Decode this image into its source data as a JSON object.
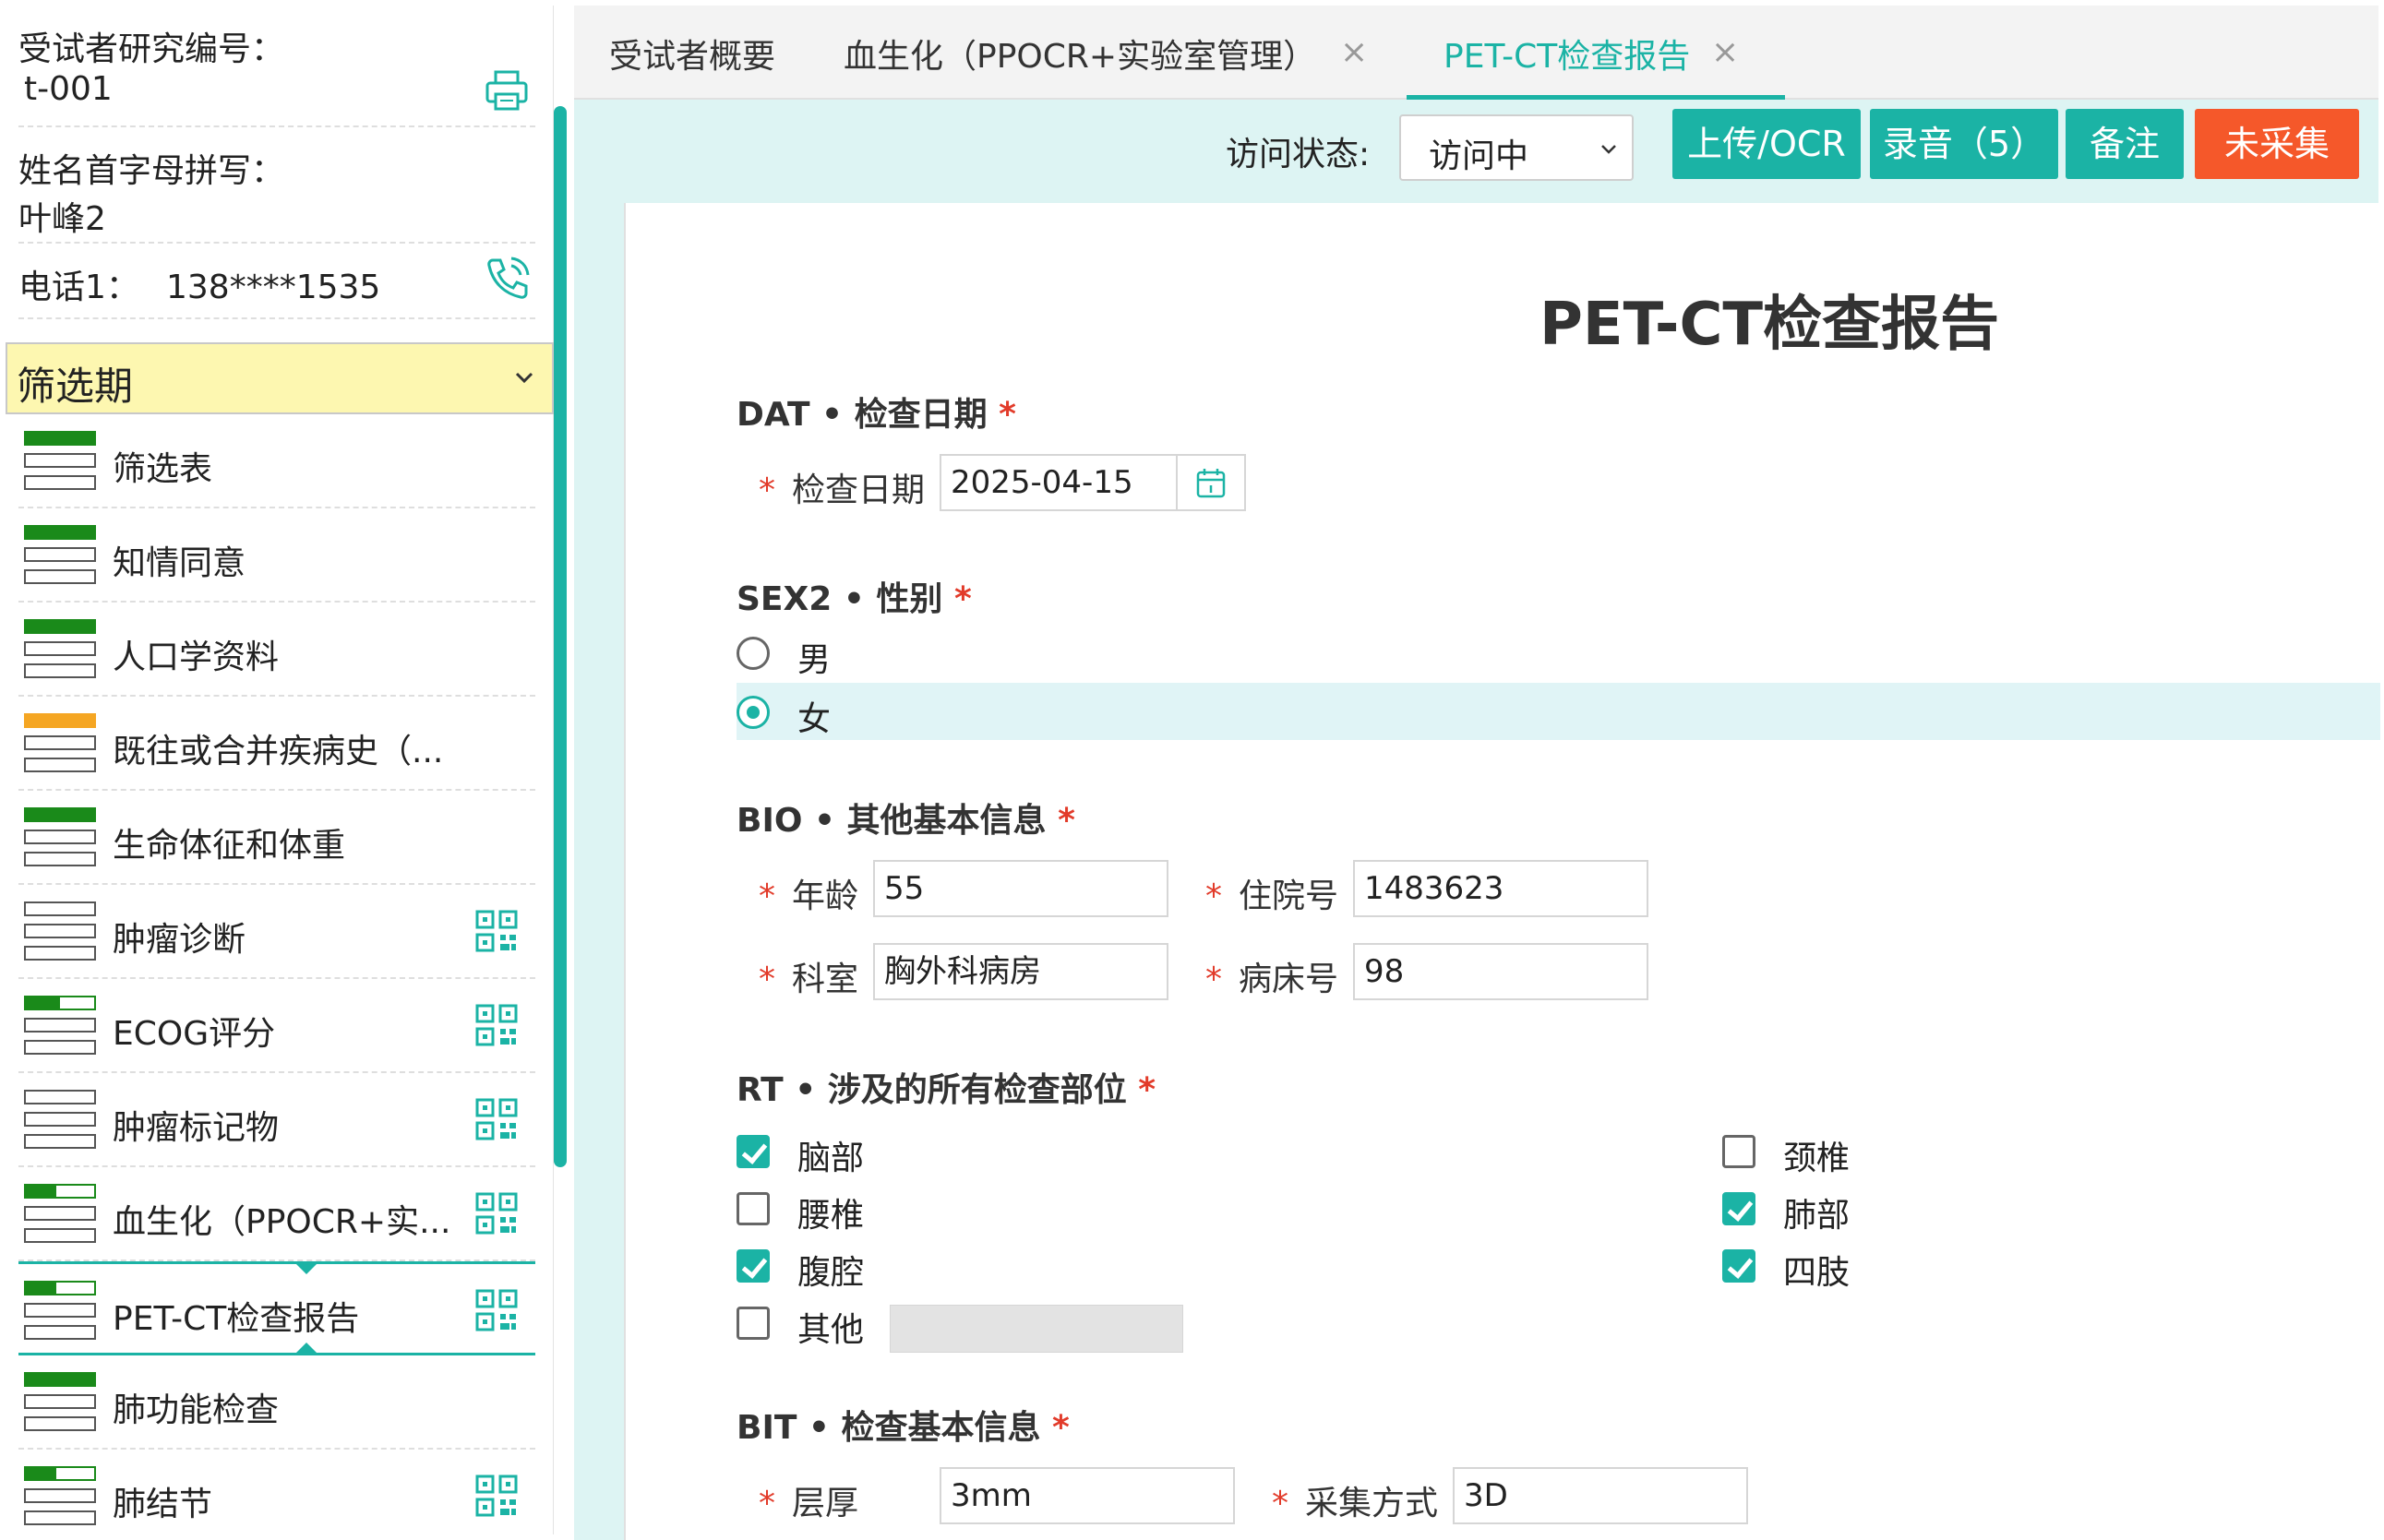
{
  "subject": {
    "id_label": "受试者研究编号：",
    "id_value": "t-001",
    "initials_label": "姓名首字母拼写：",
    "initials_value": "叶峰2",
    "phone_label": "电话1：",
    "phone_value": "138****1535"
  },
  "phase": {
    "label": "筛选期"
  },
  "forms": [
    {
      "label": "筛选表",
      "status": "complete",
      "fill": 1.0,
      "qr": false
    },
    {
      "label": "知情同意",
      "status": "complete",
      "fill": 1.0,
      "qr": false
    },
    {
      "label": "人口学资料",
      "status": "complete",
      "fill": 1.0,
      "qr": false
    },
    {
      "label": "既往或合并疾病史（...",
      "status": "partial",
      "fill": 1.0,
      "qr": false
    },
    {
      "label": "生命体征和体重",
      "status": "complete",
      "fill": 1.0,
      "qr": false
    },
    {
      "label": "肿瘤诊断",
      "status": "empty",
      "fill": 0.0,
      "qr": true
    },
    {
      "label": "ECOG评分",
      "status": "progress",
      "fill": 0.5,
      "qr": true
    },
    {
      "label": "肿瘤标记物",
      "status": "empty",
      "fill": 0.0,
      "qr": true
    },
    {
      "label": "血生化（PPOCR+实...",
      "status": "progress",
      "fill": 0.45,
      "qr": true
    },
    {
      "label": "PET-CT检查报告",
      "status": "progress",
      "fill": 0.45,
      "qr": true,
      "active": true
    },
    {
      "label": "肺功能检查",
      "status": "complete",
      "fill": 1.0,
      "qr": false
    },
    {
      "label": "肺结节",
      "status": "progress",
      "fill": 0.45,
      "qr": true
    }
  ],
  "tabs": [
    {
      "label": "受试者概要",
      "closable": false,
      "active": false
    },
    {
      "label": "血生化（PPOCR+实验室管理）",
      "closable": true,
      "active": false
    },
    {
      "label": "PET-CT检查报告",
      "closable": true,
      "active": true
    }
  ],
  "tab_close_glyph": "×",
  "toolbar": {
    "visit_label": "访问状态:",
    "visit_value": "访问中",
    "upload_label": "上传/OCR",
    "record_label": "录音（5）",
    "note_label": "备注",
    "uncollected_label": "未采集"
  },
  "form": {
    "title": "PET-CT检查报告",
    "sections": {
      "dat": {
        "title": "DAT • 检查日期",
        "required": "*"
      },
      "sex": {
        "title": "SEX2 • 性别",
        "required": "*"
      },
      "bio": {
        "title": "BIO • 其他基本信息",
        "required": "*"
      },
      "rt": {
        "title": "RT • 涉及的所有检查部位",
        "required": "*"
      },
      "bit": {
        "title": "BIT • 检查基本信息",
        "required": "*"
      }
    },
    "fields": {
      "exam_date": {
        "label": "检查日期",
        "value": "2025-04-15"
      },
      "age": {
        "label": "年龄",
        "value": "55"
      },
      "admission_no": {
        "label": "住院号",
        "value": "1483623"
      },
      "department": {
        "label": "科室",
        "value": "胸外科病房"
      },
      "bed_no": {
        "label": "病床号",
        "value": "98"
      },
      "slice_thickness": {
        "label": "层厚",
        "value": "3mm"
      },
      "acquisition": {
        "label": "采集方式",
        "value": "3D"
      }
    },
    "sex_options": [
      {
        "label": "男",
        "selected": false
      },
      {
        "label": "女",
        "selected": true
      }
    ],
    "rt_options": [
      {
        "label": "脑部",
        "checked": true
      },
      {
        "label": "颈椎",
        "checked": false
      },
      {
        "label": "腰椎",
        "checked": false
      },
      {
        "label": "肺部",
        "checked": true
      },
      {
        "label": "腹腔",
        "checked": true
      },
      {
        "label": "四肢",
        "checked": true
      },
      {
        "label": "其他",
        "checked": false
      }
    ]
  },
  "colors": {
    "accent": "#1bb3a5",
    "complete": "#1a8a1a",
    "partial": "#f5a623",
    "danger_button": "#f5582a",
    "required": "#e23b2a",
    "phase_bg": "#fdf7b0"
  }
}
